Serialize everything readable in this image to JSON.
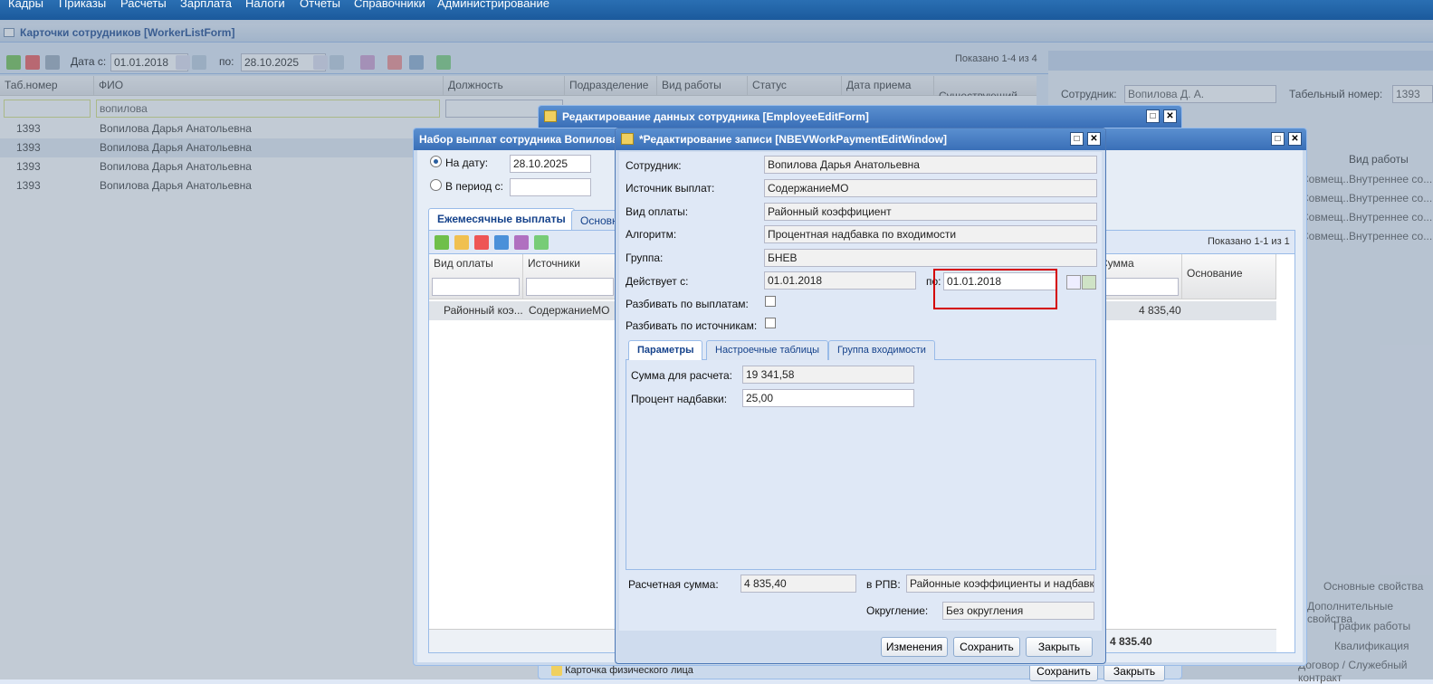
{
  "menu": [
    "Кадры",
    "Приказы",
    "Расчеты",
    "Зарплата",
    "Налоги",
    "Отчеты",
    "Справочники",
    "Администрирование"
  ],
  "main": {
    "title": "Карточки сотрудников [WorkerListForm]",
    "date_from_label": "Дата с:",
    "date_from": "01.01.2018",
    "date_to_label": "по:",
    "date_to": "28.10.2025",
    "shown": "Показано 1-4 из 4",
    "columns": [
      "Таб.номер",
      "ФИО",
      "Должность",
      "Подразделение",
      "Вид работы",
      "Статус",
      "Дата приема",
      "Существующий ..."
    ],
    "filter_fio": "вопилова",
    "rows": [
      {
        "num": "1393",
        "fio": "Вопилова Дарья Анатольевна"
      },
      {
        "num": "1393",
        "fio": "Вопилова Дарья Анатольевна"
      },
      {
        "num": "1393",
        "fio": "Вопилова Дарья Анатольевна"
      },
      {
        "num": "1393",
        "fio": "Вопилова Дарья Анатольевна"
      }
    ]
  },
  "right_panel": {
    "employee_label": "Сотрудник:",
    "employee_value": "Вопилова Д. А.",
    "tab_label": "Табельный номер:",
    "tab_value": "1393",
    "col_work": "Вид работы",
    "rows": [
      {
        "a": "Совмещ...",
        "b": "Внутреннее со..."
      },
      {
        "a": "Совмещ...",
        "b": "Внутреннее со..."
      },
      {
        "a": "Совмещ...",
        "b": "Внутреннее со..."
      },
      {
        "a": "Совмещ...",
        "b": "Внутреннее со..."
      }
    ],
    "links": [
      "Основные свойства",
      "Дополнительные свойства",
      "График работы",
      "Квалификация",
      "Договор / Служебный контракт"
    ]
  },
  "employee_edit": {
    "title": "Редактирование данных сотрудника [EmployeeEditForm]",
    "bottom_link": "Карточка физического лица",
    "save": "Сохранить",
    "close": "Закрыть"
  },
  "payments": {
    "title": "Набор выплат сотрудника Вопилова Д",
    "on_date_label": "На дату:",
    "on_date": "28.10.2025",
    "period_label": "В период с:",
    "tab_monthly": "Ежемесячные выплаты",
    "tab_main": "Основн",
    "shown": "Показано 1-1 из 1",
    "col_vid": "Вид оплаты",
    "col_src": "Источники",
    "col_sum": "Сумма",
    "col_base": "Основание",
    "row_vid": "Районный коэ...",
    "row_src": "СодержаниеМО",
    "row_sum": "4 835,40",
    "total": "4 835.40"
  },
  "edit": {
    "title": "*Редактирование записи [NBEVWorkPaymentEditWindow]",
    "employee_label": "Сотрудник:",
    "employee": "Вопилова Дарья Анатольевна",
    "source_label": "Источник выплат:",
    "source": "СодержаниеМО",
    "pay_label": "Вид оплаты:",
    "pay": "Районный коэффициент",
    "algo_label": "Алгоритм:",
    "algo": "Процентная надбавка по входимости",
    "group_label": "Группа:",
    "group": "БНЕВ",
    "from_label": "Действует с:",
    "from": "01.01.2018",
    "to_label": "по:",
    "to": "01.01.2018",
    "split_pay_label": "Разбивать по выплатам:",
    "split_src_label": "Разбивать по источникам:",
    "tabs": [
      "Параметры",
      "Настроечные таблицы",
      "Группа входимости"
    ],
    "sum_label": "Сумма для расчета:",
    "sum": "19 341,58",
    "pct_label": "Процент надбавки:",
    "pct": "25,00",
    "calc_label": "Расчетная сумма:",
    "calc": "4 835,40",
    "rpv_label": "в РПВ:",
    "rpv": "Районные коэффициенты и надбавки",
    "round_label": "Округление:",
    "round": "Без округления",
    "btn_changes": "Изменения",
    "btn_save": "Сохранить",
    "btn_close": "Закрыть"
  },
  "colors": {
    "highlight": "#d40000",
    "header": "#3a6fb8"
  }
}
